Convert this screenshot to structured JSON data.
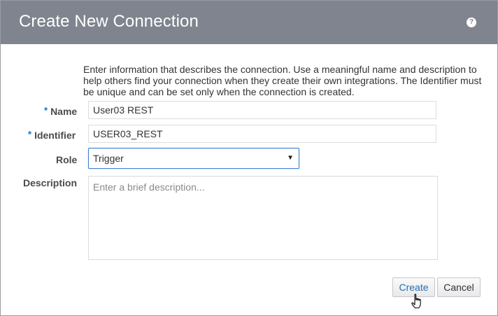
{
  "dialog": {
    "title": "Create New Connection",
    "help_icon": "?"
  },
  "intro_text": "Enter information that describes the connection. Use a meaningful name and description to help others find your connection when they create their own integrations. The Identifier must be unique and can be set only when the connection is created.",
  "form": {
    "required_marker": "*",
    "name": {
      "label": "Name",
      "value": "User03 REST"
    },
    "identifier": {
      "label": "Identifier",
      "value": "USER03_REST"
    },
    "role": {
      "label": "Role",
      "value": "Trigger",
      "arrow": "▼"
    },
    "description": {
      "label": "Description",
      "placeholder": "Enter a brief description...",
      "value": ""
    }
  },
  "buttons": {
    "create": "Create",
    "cancel": "Cancel"
  },
  "icons": {
    "help": "help-icon",
    "dropdown": "chevron-down-icon",
    "cursor": "hand-pointer-icon"
  }
}
